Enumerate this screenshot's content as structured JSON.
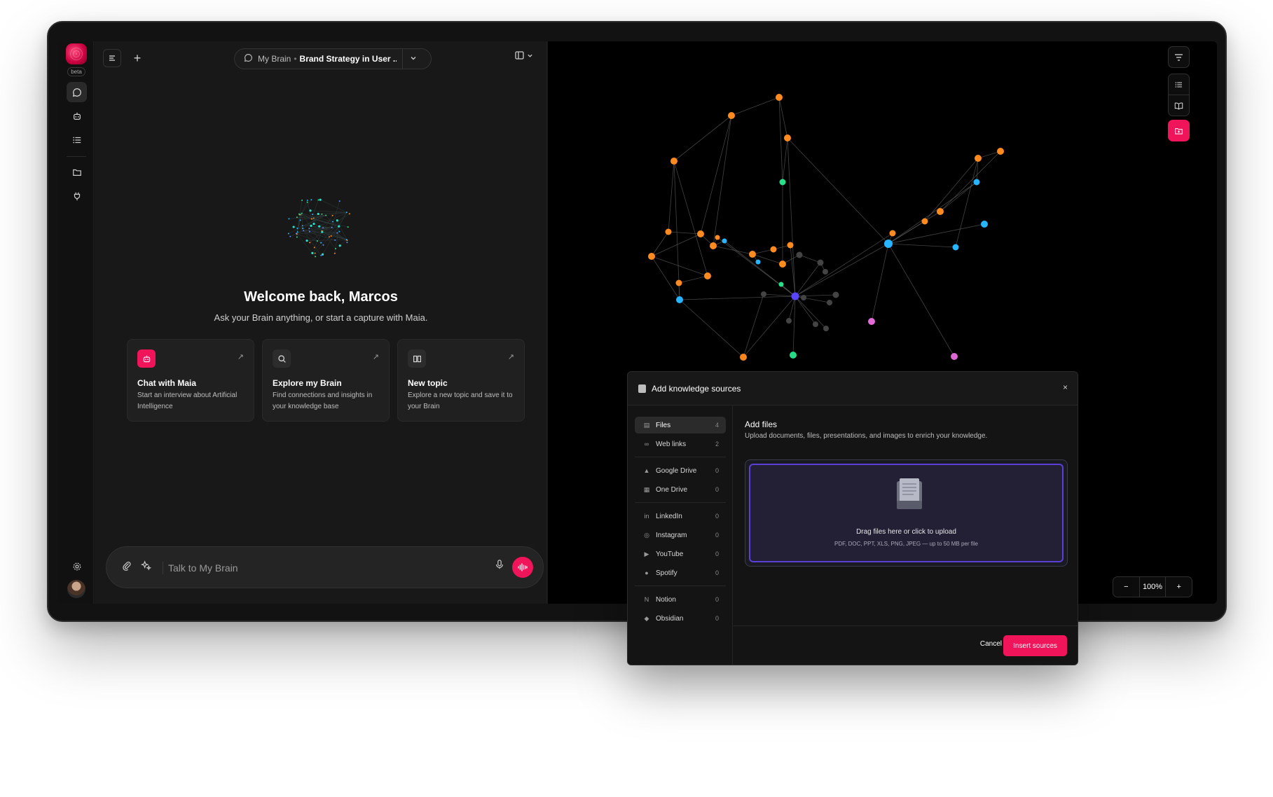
{
  "sidebar": {
    "badge": "beta",
    "items": [
      {
        "name": "chat",
        "icon": "chat-bubble-icon"
      },
      {
        "name": "maia",
        "icon": "bot-icon"
      },
      {
        "name": "list",
        "icon": "list-icon"
      },
      {
        "name": "folder",
        "icon": "folder-icon"
      },
      {
        "name": "plug",
        "icon": "plug-icon"
      }
    ],
    "settings_icon": "gear-icon"
  },
  "header": {
    "brain": "My Brain",
    "separator": "•",
    "topic": "Brand Strategy in User ..."
  },
  "welcome": {
    "title": "Welcome back, Marcos",
    "subtitle": "Ask your Brain anything, or start a capture with Maia."
  },
  "cards": [
    {
      "title": "Chat with Maia",
      "desc": "Start an interview about Artificial Intelligence",
      "icon": "bot-icon"
    },
    {
      "title": "Explore my Brain",
      "desc": "Find connections and insights in your knowledge base",
      "icon": "search-icon"
    },
    {
      "title": "New topic",
      "desc": "Explore a new topic and save it to your Brain",
      "icon": "book-icon"
    }
  ],
  "input": {
    "placeholder": "Talk to My Brain"
  },
  "graph": {
    "zoom": "100%",
    "colors": {
      "orange": "#ff8a1f",
      "cyan": "#27b5ff",
      "green": "#27e08a",
      "pink": "#e36bd8",
      "gray": "#444444",
      "purple": "#5a44ff"
    }
  },
  "modal": {
    "title": "Add knowledge sources",
    "close": "×",
    "sources": [
      {
        "label": "Files",
        "count": "4"
      },
      {
        "label": "Web links",
        "count": "2"
      },
      {
        "label": "Google Drive",
        "count": "0"
      },
      {
        "label": "One Drive",
        "count": "0"
      },
      {
        "label": "LinkedIn",
        "count": "0"
      },
      {
        "label": "Instagram",
        "count": "0"
      },
      {
        "label": "YouTube",
        "count": "0"
      },
      {
        "label": "Spotify",
        "count": "0"
      },
      {
        "label": "Notion",
        "count": "0"
      },
      {
        "label": "Obsidian",
        "count": "0"
      }
    ],
    "heading": "Add files",
    "description": "Upload documents, files, presentations, and images to enrich your knowledge.",
    "drop_title": "Drag files here or click to upload",
    "drop_subtitle": "PDF, DOC, PPT, XLS, PNG, JPEG — up to 50 MB per file",
    "cancel": "Cancel",
    "insert": "Insert sources"
  },
  "brand": {
    "accent": "#f0145a",
    "dropzone_border": "#5b3fd6"
  }
}
